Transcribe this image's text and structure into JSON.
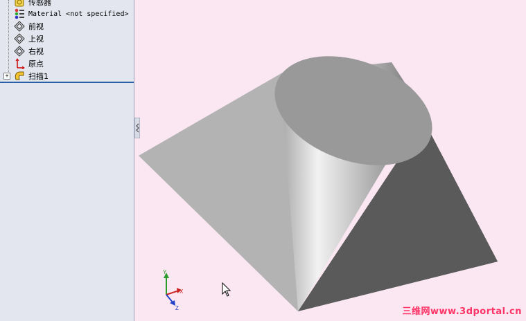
{
  "tree": {
    "items": [
      {
        "label": "传感器",
        "icon": "sensor-icon"
      },
      {
        "label": "Material <not specified>",
        "icon": "material-icon"
      },
      {
        "label": "前视",
        "icon": "plane-icon"
      },
      {
        "label": "上视",
        "icon": "plane-icon"
      },
      {
        "label": "右视",
        "icon": "plane-icon"
      },
      {
        "label": "原点",
        "icon": "origin-icon"
      },
      {
        "label": "扫描1",
        "icon": "sweep-icon"
      }
    ]
  },
  "expander_symbol": "+",
  "triad": {
    "x": "X",
    "y": "Y",
    "z": "Z"
  },
  "watermark": "三维网www.3dportal.cn",
  "colors": {
    "background": "#fbe7f1",
    "sidebar": "#e3e6ee",
    "rollback_bar": "#2a5fa8"
  }
}
